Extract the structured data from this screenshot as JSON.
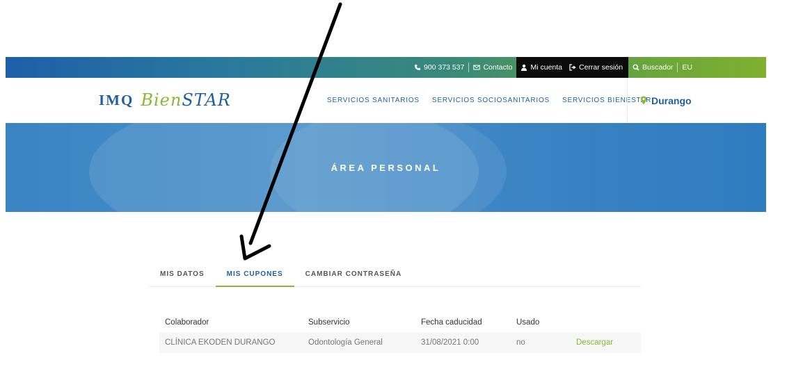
{
  "topbar": {
    "phone": "900 373 537",
    "contact": "Contacto",
    "account": "Mi cuenta",
    "logout": "Cerrar sesión",
    "search": "Buscador",
    "language": "EU"
  },
  "header": {
    "logo_imq": "IMQ",
    "logo_bien": "Bien",
    "logo_star": "STAR",
    "nav": [
      {
        "label": "SERVICIOS SANITARIOS"
      },
      {
        "label": "SERVICIOS SOCIOSANITARIOS"
      },
      {
        "label": "SERVICIOS BIENESTAR"
      }
    ],
    "location": "Durango"
  },
  "hero": {
    "title": "ÁREA PERSONAL"
  },
  "tabs": [
    {
      "label": "MIS DATOS",
      "active": false
    },
    {
      "label": "MIS CUPONES",
      "active": true
    },
    {
      "label": "CAMBIAR CONTRASEÑA",
      "active": false
    }
  ],
  "coupons_table": {
    "headers": [
      "Colaborador",
      "Subservicio",
      "Fecha caducidad",
      "Usado",
      ""
    ],
    "rows": [
      {
        "colaborador": "CLÍNICA EKODEN DURANGO",
        "subservicio": "Odontología General",
        "fecha": "31/08/2021 0:00",
        "usado": "no",
        "action": "Descargar"
      }
    ]
  },
  "colors": {
    "brand_blue": "#1f5f9e",
    "brand_green": "#8ab833",
    "hero_blue": "#3a84c4",
    "account_bg": "#0b0b0b"
  },
  "icons": [
    "phone-icon",
    "envelope-icon",
    "user-icon",
    "logout-icon",
    "search-icon",
    "map-pin-icon"
  ]
}
